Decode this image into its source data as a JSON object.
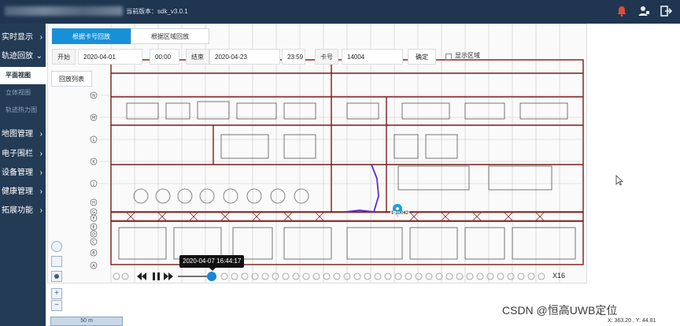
{
  "header": {
    "version_label": "当前版本：sdk_v3.0.1"
  },
  "sidebar": {
    "items": [
      {
        "label": "实时显示",
        "chevron": "›"
      },
      {
        "label": "轨迹回放",
        "chevron": "⌄"
      },
      {
        "label": "地图管理",
        "chevron": "›"
      },
      {
        "label": "电子围栏",
        "chevron": "›"
      },
      {
        "label": "设备管理",
        "chevron": "›"
      },
      {
        "label": "健康管理",
        "chevron": "›"
      },
      {
        "label": "拓展功能",
        "chevron": "›"
      }
    ],
    "subitems": [
      {
        "label": "平面视图"
      },
      {
        "label": "立体视图"
      },
      {
        "label": "轨迹热力图"
      }
    ]
  },
  "tabs": [
    {
      "label": "根据卡号回放",
      "active": true
    },
    {
      "label": "根据区域回放",
      "active": false
    }
  ],
  "filters": {
    "start_label": "开始",
    "start_date": "2020-04-01",
    "start_time": "00:00",
    "end_label": "结束",
    "end_date": "2020-04-23",
    "end_time": "23:59",
    "card_label": "卡号",
    "card_value": "14004",
    "confirm_label": "确定",
    "show_area_label": "显示区域",
    "show_area_checked": false
  },
  "playlist_button": "回放列表",
  "map": {
    "row_labels": [
      "N",
      "M",
      "L",
      "K",
      "J",
      "H",
      "G",
      "F",
      "E",
      "D",
      "C",
      "B",
      "A"
    ],
    "tag_label": "1-10042"
  },
  "playback": {
    "tooltip_time": "2020-04-07 16:44:17",
    "speed": "X16",
    "progress": 0.15
  },
  "zoom": {
    "in_label": "+",
    "out_label": "−"
  },
  "scale_label": "50 m",
  "watermark": "CSDN @恒高UWB定位",
  "coords": "X: 363.20 ,  Y: 44.81",
  "colors": {
    "topbar": "#1f3550",
    "sidebar": "#243b55",
    "accent": "#1890d8",
    "track": "#5a2bd8",
    "walls": "#7a1a1a"
  }
}
